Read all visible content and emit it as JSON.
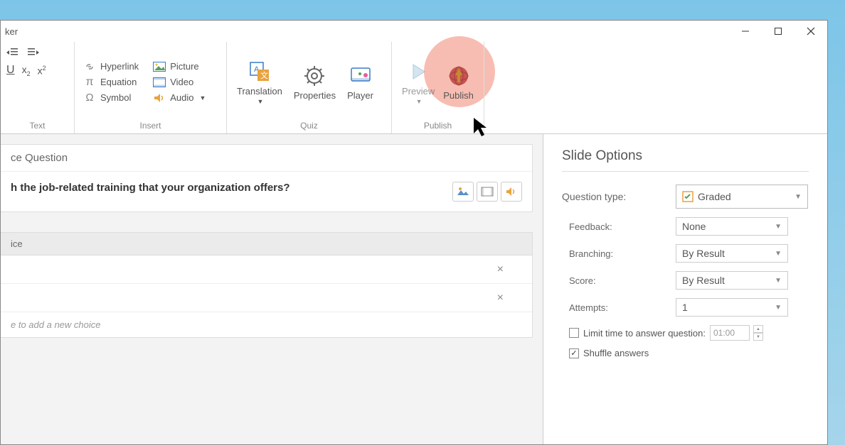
{
  "titlebar": {
    "title_fragment": "ker"
  },
  "ribbon": {
    "text_group": {
      "label": "Text"
    },
    "insert_group": {
      "label": "Insert",
      "hyperlink": "Hyperlink",
      "equation": "Equation",
      "symbol": "Symbol",
      "picture": "Picture",
      "video": "Video",
      "audio": "Audio"
    },
    "quiz_group": {
      "label": "Quiz",
      "translation": "Translation",
      "properties": "Properties",
      "player": "Player"
    },
    "publish_group": {
      "label": "Publish",
      "preview": "Preview",
      "publish": "Publish"
    }
  },
  "question": {
    "header_fragment": "ce Question",
    "text_fragment": "h the job-related training that your organization offers?"
  },
  "choices": {
    "header_fragment": "ice",
    "placeholder_fragment": "e to add a new choice"
  },
  "slide_options": {
    "title": "Slide Options",
    "question_type_label": "Question type:",
    "question_type_value": "Graded",
    "feedback_label": "Feedback:",
    "feedback_value": "None",
    "branching_label": "Branching:",
    "branching_value": "By Result",
    "score_label": "Score:",
    "score_value": "By Result",
    "attempts_label": "Attempts:",
    "attempts_value": "1",
    "limit_time_label": "Limit time to answer question:",
    "limit_time_value": "01:00",
    "shuffle_label": "Shuffle answers"
  }
}
